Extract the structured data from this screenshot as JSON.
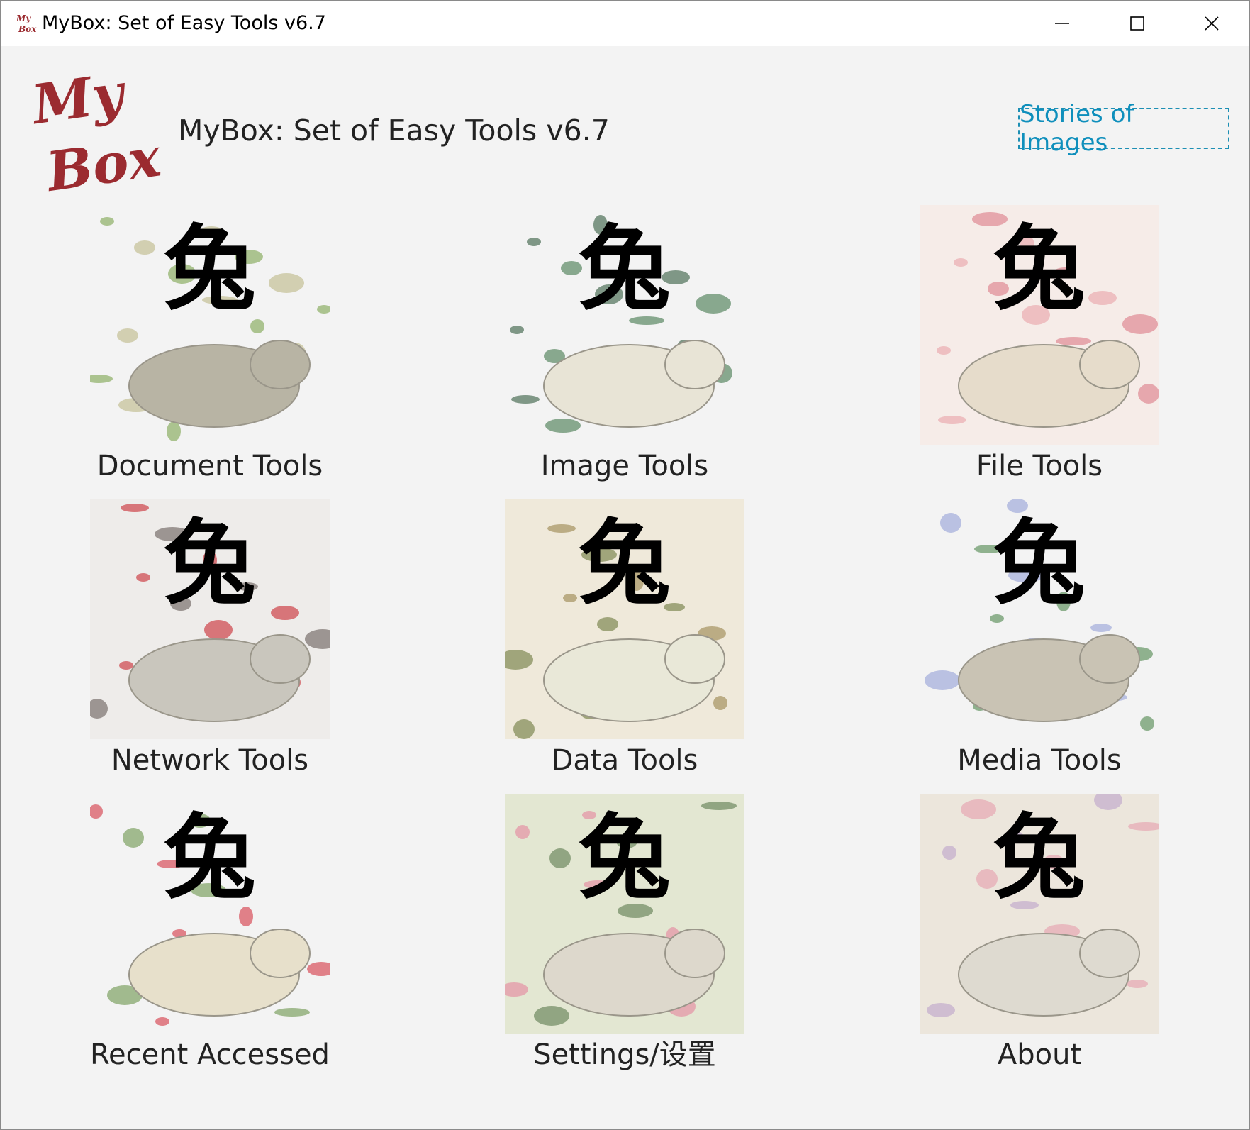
{
  "window": {
    "title": "MyBox: Set of Easy Tools v6.7",
    "icon": "mybox-logo-icon",
    "controls": [
      "minimize-icon",
      "maximize-icon",
      "close-icon"
    ]
  },
  "header": {
    "app_title": "MyBox: Set of Easy Tools v6.7",
    "stories_link": "Stories of Images",
    "logo_text_line1": "My",
    "logo_text_line2": "Box",
    "link_color": "#0f8fbc",
    "logo_color": "#9b2b30"
  },
  "tools": [
    {
      "label": "Document Tools",
      "glyph": "兔",
      "theme": "willow-swallow"
    },
    {
      "label": "Image Tools",
      "glyph": "兔",
      "theme": "bamboo-jade-figure"
    },
    {
      "label": "File Tools",
      "glyph": "兔",
      "theme": "pink-blossom"
    },
    {
      "label": "Network Tools",
      "glyph": "兔",
      "theme": "plum-branch"
    },
    {
      "label": "Data Tools",
      "glyph": "兔",
      "theme": "butterfly-chrysanthemum"
    },
    {
      "label": "Media Tools",
      "glyph": "兔",
      "theme": "orchid-grass"
    },
    {
      "label": "Recent Accessed",
      "glyph": "兔",
      "theme": "red-flowers"
    },
    {
      "label": "Settings/设置",
      "glyph": "兔",
      "theme": "lotus"
    },
    {
      "label": "About",
      "glyph": "兔",
      "theme": "peony"
    }
  ]
}
